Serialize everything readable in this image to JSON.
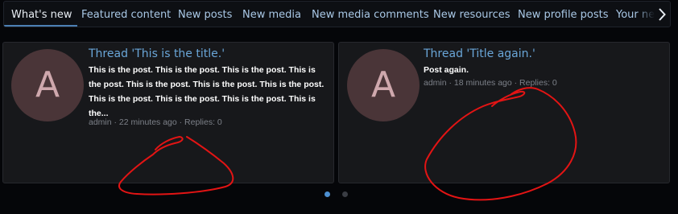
{
  "tabs": [
    {
      "label": "What's new",
      "active": true
    },
    {
      "label": "Featured content",
      "active": false
    },
    {
      "label": "New posts",
      "active": false
    },
    {
      "label": "New media",
      "active": false
    },
    {
      "label": "New media comments",
      "active": false
    },
    {
      "label": "New resources",
      "active": false
    },
    {
      "label": "New profile posts",
      "active": false
    },
    {
      "label": "Your news feed",
      "active": false
    }
  ],
  "cards": [
    {
      "avatar_letter": "A",
      "title": "Thread 'This is the title.'",
      "snippet_lines": [
        "This is the post. This is the post. This is the post. This is",
        "the post. This is the post. This is the post. This is the post.",
        "This is the post. This is the post. This is the post. This is",
        "the..."
      ],
      "meta": "admin · 22 minutes ago · Replies: 0"
    },
    {
      "avatar_letter": "A",
      "title": "Thread 'Title again.'",
      "snippet_lines": [
        "Post again."
      ],
      "meta": "admin · 18 minutes ago · Replies: 0"
    }
  ],
  "pager": {
    "pages": 2,
    "current": 1
  },
  "icons": {
    "next": "chevron-right-icon"
  },
  "colors": {
    "accent": "#4c7fb3",
    "link": "#6aa6d8",
    "annotation": "#e31414",
    "avatar_bg": "#4a3538"
  }
}
